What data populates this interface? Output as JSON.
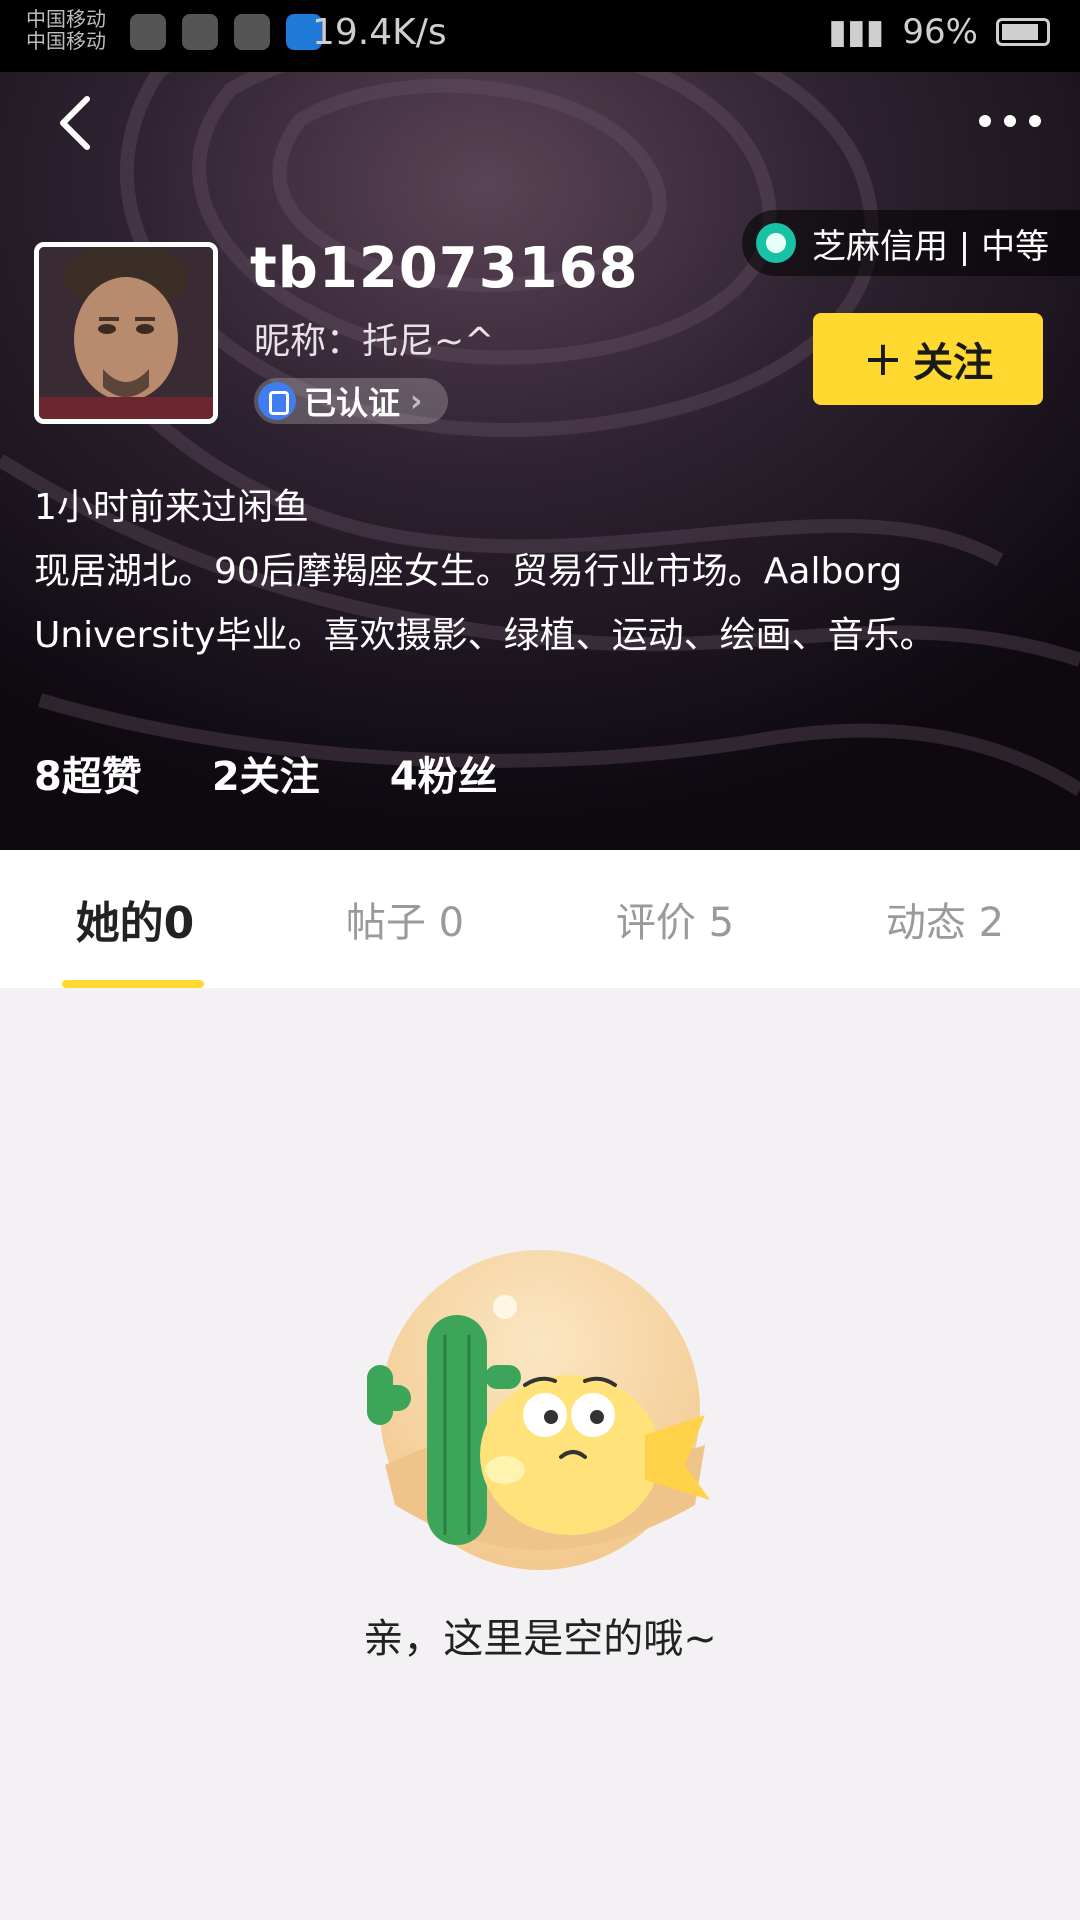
{
  "status_bar": {
    "carrier_line1": "中国移动",
    "carrier_line2": "中国移动",
    "net_speed": "19.4K/s",
    "battery_percent": "96%"
  },
  "profile": {
    "username": "tb12073168",
    "nickname": "昵称：托尼~^",
    "verified_label": "已认证",
    "credit_label": "芝麻信用 | 中等",
    "follow_label": "关注",
    "last_seen": "1小时前来过闲鱼",
    "bio": "现居湖北。90后摩羯座女生。贸易行业市场。Aalborg University毕业。喜欢摄影、绿植、运动、绘画、音乐。"
  },
  "stats": {
    "likes": "8超赞",
    "following": "2关注",
    "followers": "4粉丝"
  },
  "tabs": [
    {
      "label": "她的0"
    },
    {
      "label": "帖子 0"
    },
    {
      "label": "评价 5"
    },
    {
      "label": "动态 2"
    }
  ],
  "empty_state": {
    "message": "亲，这里是空的哦~"
  },
  "colors": {
    "accent": "#ffd930",
    "credit": "#19c2a6",
    "verified": "#3f7df0"
  }
}
